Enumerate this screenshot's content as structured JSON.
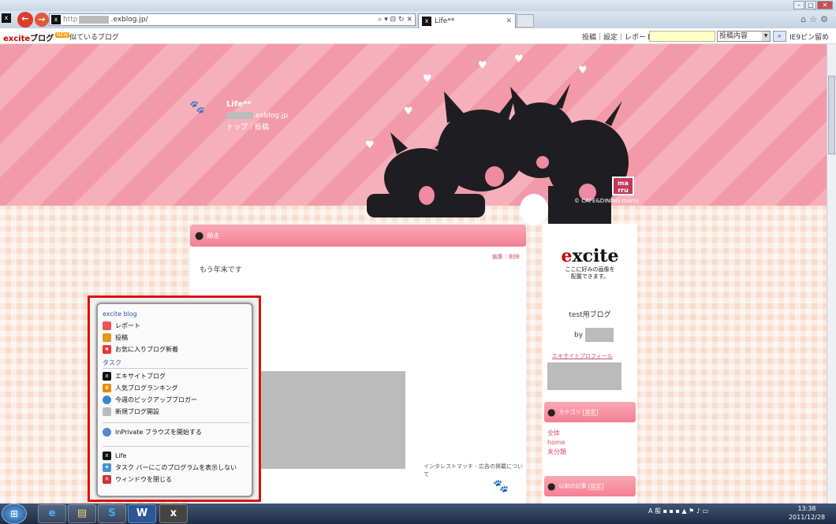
{
  "browser": {
    "url_prefix": "http",
    "url_suffix": ".exblog.jp/",
    "tab_title": "Life**"
  },
  "excite_bar": {
    "logo": "excite",
    "logo_suffix": "ブログ",
    "new_badge": "NEW",
    "similar_blogs": "似ているブログ",
    "links": "投稿｜設定｜レポート",
    "search_select": "投稿内容",
    "ie9_pin": "IE9ピン留め"
  },
  "header": {
    "blog_title": "Life**",
    "url_suffix": ".exblog.jp",
    "nav": "トップ｜投稿",
    "badge": "ma\nrru",
    "copyright": "© CAFE&DINING marru"
  },
  "post": {
    "heading": "師走",
    "edit_links": "編集｜削除",
    "body": "もう年末です",
    "ad_link": "インタレストマッチ - 広告の掲載について"
  },
  "sidebar": {
    "logo_a": "e",
    "logo_b": "xcite",
    "logo_caption_1": "ここに好みの画像を",
    "logo_caption_2": "配置できます。",
    "title": "test用ブログ",
    "by": "by",
    "profile_link": "エキサイトプロフィール",
    "category_head": "カテゴリ",
    "category_setting": "[設定]",
    "categories": [
      "全体",
      "home",
      "未分類"
    ],
    "recent_head": "以前の記事",
    "recent_setting": "[設定]"
  },
  "jumplist": {
    "section_blog": "excite blog",
    "blog_items": [
      "レポート",
      "投稿",
      "お気に入りブログ新着"
    ],
    "section_task": "タスク",
    "task_items": [
      "エキサイトブログ",
      "人気ブログランキング",
      "今週のピックアップブロガー",
      "新規ブログ開設"
    ],
    "inprivate": "InPrivate ブラウズを開始する",
    "app_items": [
      "Life",
      "タスク バーにこのプログラムを表示しない",
      "ウィンドウを閉じる"
    ]
  },
  "taskbar": {
    "tray_text": "A 般",
    "clock_time": "13:38",
    "clock_date": "2011/12/28"
  },
  "colors": {
    "accent_pink": "#f57f92",
    "highlight_red": "#e01010"
  }
}
